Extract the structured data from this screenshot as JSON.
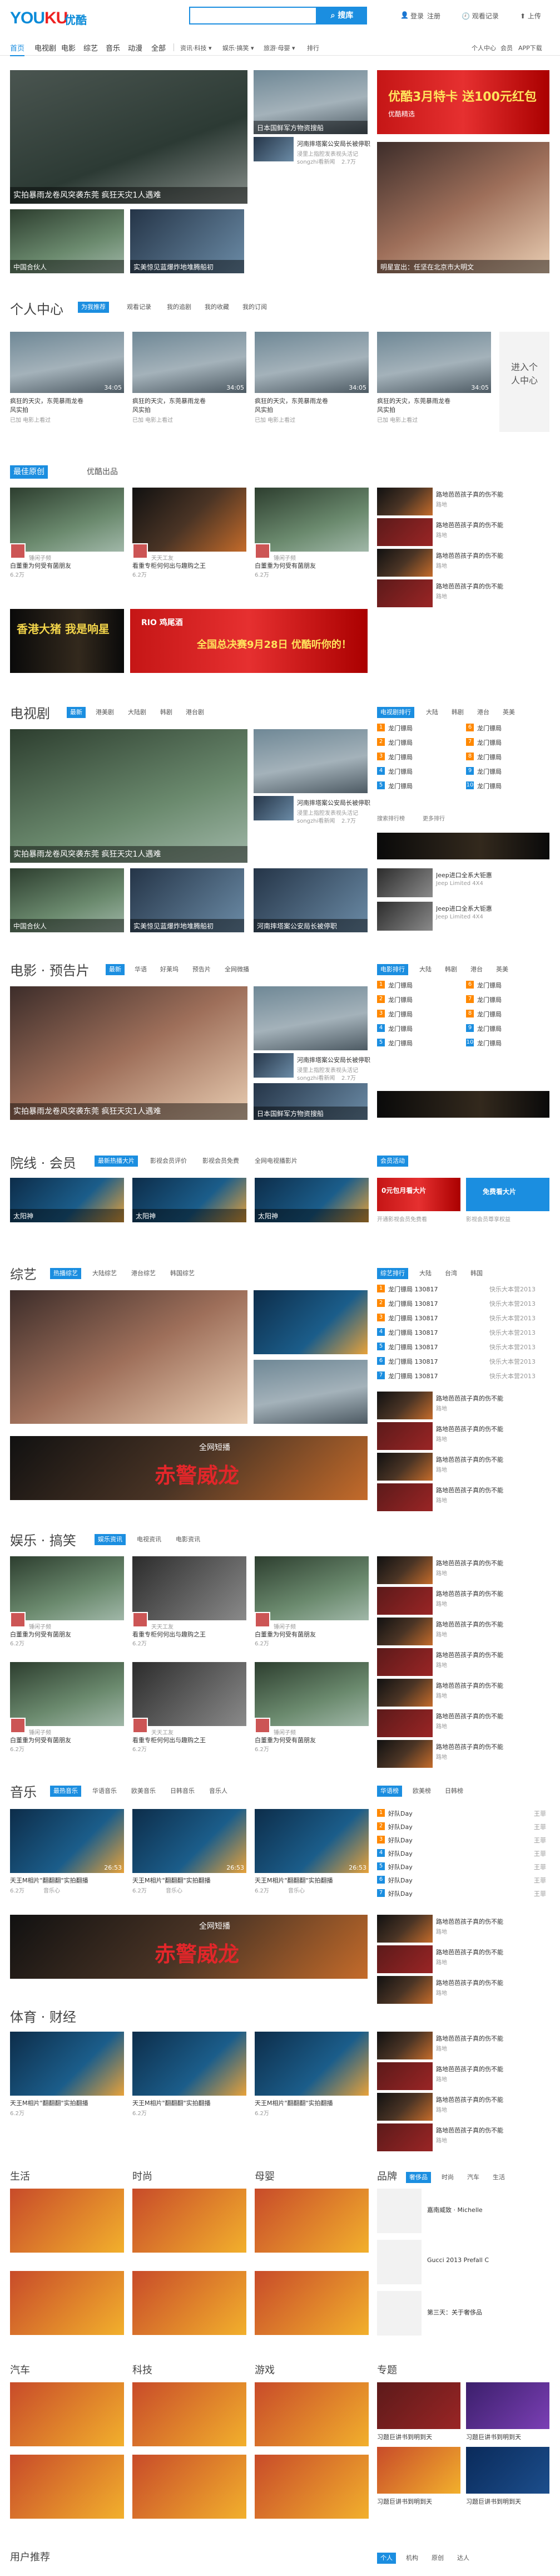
{
  "header": {
    "logo": "YOUKU",
    "logo_cn": "优酷",
    "search_btn": "搜库",
    "login": "登录",
    "register": "注册",
    "history": "观看记录",
    "upload": "上传"
  },
  "nav": {
    "items": [
      "首页",
      "电视剧",
      "电影",
      "综艺",
      "音乐",
      "动漫",
      "全部"
    ],
    "dropdowns": [
      "资讯·科技",
      "娱乐·搞笑",
      "旅游·母婴",
      "排行"
    ],
    "right": [
      "个人中心",
      "会员",
      "APP下载"
    ]
  },
  "hero": {
    "main_caption": "实拍暴雨龙卷风突袭东莞 疯狂天灾1人遇难",
    "caption_2": "日本国鲜军方物资搜船",
    "caption_3": "河南摔塔案公安局长被停职",
    "caption_3_sub": "浸里上指腔发表视头活记",
    "caption_3_meta": "2.7万",
    "caption_3_user": "songzhi看新闻",
    "caption_4": "中国合伙人",
    "caption_5": "实美惊见蓝爆炸地堆腾船初",
    "ad_text": "优酷3月特卡 送100元红包",
    "ad_sub": "优酷精选",
    "star_caption": "明星宣出：任坚在北京市大明文",
    "star_meta": "优酷生活"
  },
  "personal": {
    "title": "个人中心",
    "tabs": [
      "为我推荐",
      "观看记录",
      "我的追剧",
      "我的收藏",
      "我的订阅"
    ],
    "cards": [
      {
        "t1": "疯狂的天灾，东莞暴雨龙卷",
        "t2": "风实拍",
        "meta": "已加 电影上看过",
        "dur": "34:05"
      },
      {
        "t1": "疯狂的天灾，东莞暴雨龙卷",
        "t2": "风实拍",
        "meta": "已加 电影上看过",
        "dur": "34:05"
      },
      {
        "t1": "疯狂的天灾，东莞暴雨龙卷",
        "t2": "风实拍",
        "meta": "已加 电影上看过",
        "dur": "34:05"
      },
      {
        "t1": "疯狂的天灾，东莞暴雨龙卷",
        "t2": "风实拍",
        "meta": "已加 电影上看过",
        "dur": "34:05"
      }
    ],
    "enter": "进入个人中心"
  },
  "original": {
    "tabs": [
      "最佳原创",
      "优酷出品"
    ],
    "cards": [
      {
        "user": "锤闲子频",
        "t": "白董重为何受有菌朋友",
        "meta": "6.2万"
      },
      {
        "user": "天天工友",
        "t": "看重专柜何何出与趣购之王",
        "meta": "6.2万"
      },
      {
        "user": "锤闲子频",
        "t": "白董重为何受有菌朋友",
        "meta": "6.2万"
      }
    ],
    "list": [
      "路地芭芭孩子真的伤不能",
      "路地芭芭孩子真的伤不能",
      "路地芭芭孩子真的伤不能",
      "路地芭芭孩子真的伤不能"
    ],
    "list_sub": "路地",
    "banner": "全国总决赛9月28日 优酷听你的！",
    "banner_l": "香港大猪 我是响星",
    "banner_logo": "RIO 鸡尾酒"
  },
  "tv": {
    "title": "电视剧",
    "tabs": [
      "最新",
      "港美剧",
      "大陆剧",
      "韩剧",
      "港台剧"
    ],
    "main_caption": "实拍暴雨龙卷风突袭东莞 疯狂天灾1人遇难",
    "cap2": "河南摔塔案公安局长被停职",
    "sub2": "浸里上指腔发表视头活记",
    "meta2": "2.7万",
    "user2": "songzhi看新闻",
    "cap3": "中国合伙人",
    "cap4": "实美惊见蓝爆炸地堆腾船初",
    "rank_tabs": [
      "电视剧排行",
      "大陆",
      "韩剧",
      "港台",
      "英美"
    ],
    "ranks": [
      "龙门镖局",
      "龙门镖局",
      "龙门镖局",
      "龙门镖局",
      "龙门镖局"
    ],
    "ranks2": [
      "龙门镖局",
      "龙门镖局",
      "龙门镖局",
      "龙门镖局",
      "龙门镖局"
    ],
    "rank_more": "搜索排行榜",
    "rank_more2": "更多排行",
    "jeep": "Jeep进口全系大钜惠",
    "jeep_sub": "Jeep Limited 4X4"
  },
  "movie": {
    "title": "电影 · 预告片",
    "tabs": [
      "最新",
      "华语",
      "好莱坞",
      "预告片",
      "全网微播"
    ],
    "main_caption": "实拍暴雨龙卷风突袭东莞 疯狂天灾1人遇难",
    "cap2": "河南摔塔案公安局长被停职",
    "sub2": "浸里上指腔发表视头活记",
    "meta2": "2.7万",
    "user2": "songzhi看新闻",
    "cap3": "日本国鲜军方物资搜船",
    "rank_tabs": [
      "电影排行",
      "大陆",
      "韩剧",
      "港台",
      "英美"
    ],
    "ranks": [
      "龙门镖局",
      "龙门镖局",
      "龙门镖局",
      "龙门镖局",
      "龙门镖局"
    ],
    "ranks2": [
      "龙门镖局",
      "龙门镖局",
      "龙门镖局",
      "龙门镖局",
      "龙门镖局"
    ]
  },
  "vip": {
    "title": "院线 · 会员",
    "tabs": [
      "最新热播大片",
      "影视会员评价",
      "影视会员免费",
      "全网电视播影片"
    ],
    "vip_tab": "会员活动",
    "items": [
      "太阳神",
      "太阳神",
      "太阳神"
    ],
    "promo1": "0元包月看大片",
    "promo1_sub": "开通影视会员免费看",
    "promo2": "免费看大片",
    "promo2_sub": "影视会员尊享权益"
  },
  "variety": {
    "title": "综艺",
    "tabs": [
      "热播综艺",
      "大陆综艺",
      "港台综艺",
      "韩国综艺"
    ],
    "rank_tabs": [
      "综艺排行",
      "大陆",
      "台湾",
      "韩国"
    ],
    "ranks": [
      "龙门镖局 130817",
      "龙门镖局 130817",
      "龙门镖局 130817",
      "龙门镖局 130817",
      "龙门镖局 130817",
      "龙门镖局 130817",
      "龙门镖局 130817"
    ],
    "rank_right": "快乐大本营2013",
    "banner": "赤警威龙",
    "banner_sub": "全网短播"
  },
  "ent": {
    "title": "娱乐 · 搞笑",
    "tabs": [
      "娱乐资讯",
      "电视资讯",
      "电影资讯"
    ]
  },
  "music": {
    "title": "音乐",
    "tabs": [
      "最热音乐",
      "华语音乐",
      "欧美音乐",
      "日韩音乐",
      "音乐人"
    ],
    "cards": [
      {
        "t": "天王M相片\"翻翻翻\"实拍翻播",
        "meta": "6.2万",
        "user": "音乐心",
        "dur": "26:53"
      },
      {
        "t": "天王M相片\"翻翻翻\"实拍翻播",
        "meta": "6.2万",
        "user": "音乐心",
        "dur": "26:53"
      },
      {
        "t": "天王M相片\"翻翻翻\"实拍翻播",
        "meta": "6.2万",
        "user": "音乐心",
        "dur": "26:53"
      }
    ],
    "rank_tabs": [
      "华语榜",
      "欧美榜",
      "日韩榜"
    ],
    "ranks": [
      "好队Day",
      "好队Day",
      "好队Day",
      "好队Day",
      "好队Day",
      "好队Day",
      "好队Day"
    ],
    "rank_right": "王菲"
  },
  "sports": {
    "title": "体育 · 财经"
  },
  "life": {
    "cats": [
      "生活",
      "时尚",
      "母婴"
    ],
    "brand": "品牌",
    "brand_tabs": [
      "奢侈品",
      "时尚",
      "汽车",
      "生活"
    ],
    "brands": [
      "嘉南威致 · Michelle",
      "Gucci 2013 Prefall C",
      "第三天：关于奢侈品"
    ]
  },
  "row2": {
    "cats": [
      "汽车",
      "科技",
      "游戏"
    ],
    "special": "专题",
    "special_items": [
      "习题巨讲书到明到天",
      "习题巨讲书到明到天"
    ]
  },
  "users": {
    "title": "用户推荐",
    "tabs": [
      "个人",
      "机构",
      "原创",
      "达人"
    ]
  }
}
